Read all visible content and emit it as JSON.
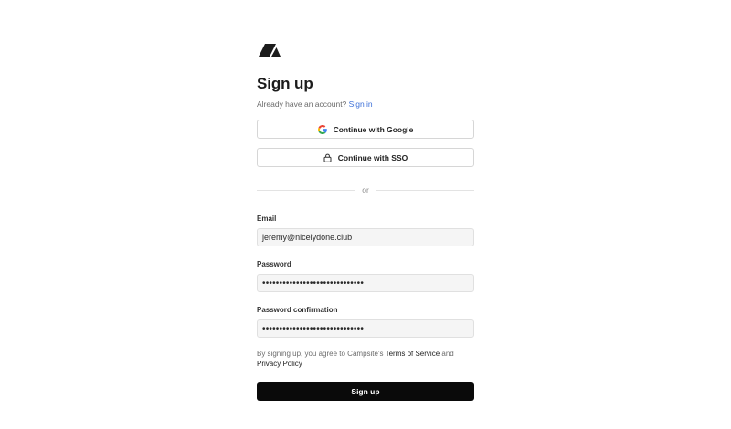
{
  "logo": {
    "icon": "campsite-logo-icon"
  },
  "header": {
    "title": "Sign up",
    "have_account_text": "Already have an account?",
    "sign_in_link": "Sign in"
  },
  "oauth": {
    "google_label": "Continue with Google",
    "sso_label": "Continue with SSO"
  },
  "divider_text": "or",
  "form": {
    "email_label": "Email",
    "email_value": "jeremy@nicelydone.club",
    "password_label": "Password",
    "password_value": "••••••••••••••••••••••••••••••",
    "password_confirmation_label": "Password confirmation",
    "password_confirmation_value": "••••••••••••••••••••••••••••••"
  },
  "terms": {
    "prefix": "By signing up, you agree to Campsite's",
    "tos_link": "Terms of Service",
    "and": "and",
    "privacy_link": "Privacy Policy"
  },
  "submit_label": "Sign up",
  "colors": {
    "link": "#3b6fd8",
    "primary_button": "#0a0a0a",
    "input_bg": "#f5f5f5"
  }
}
